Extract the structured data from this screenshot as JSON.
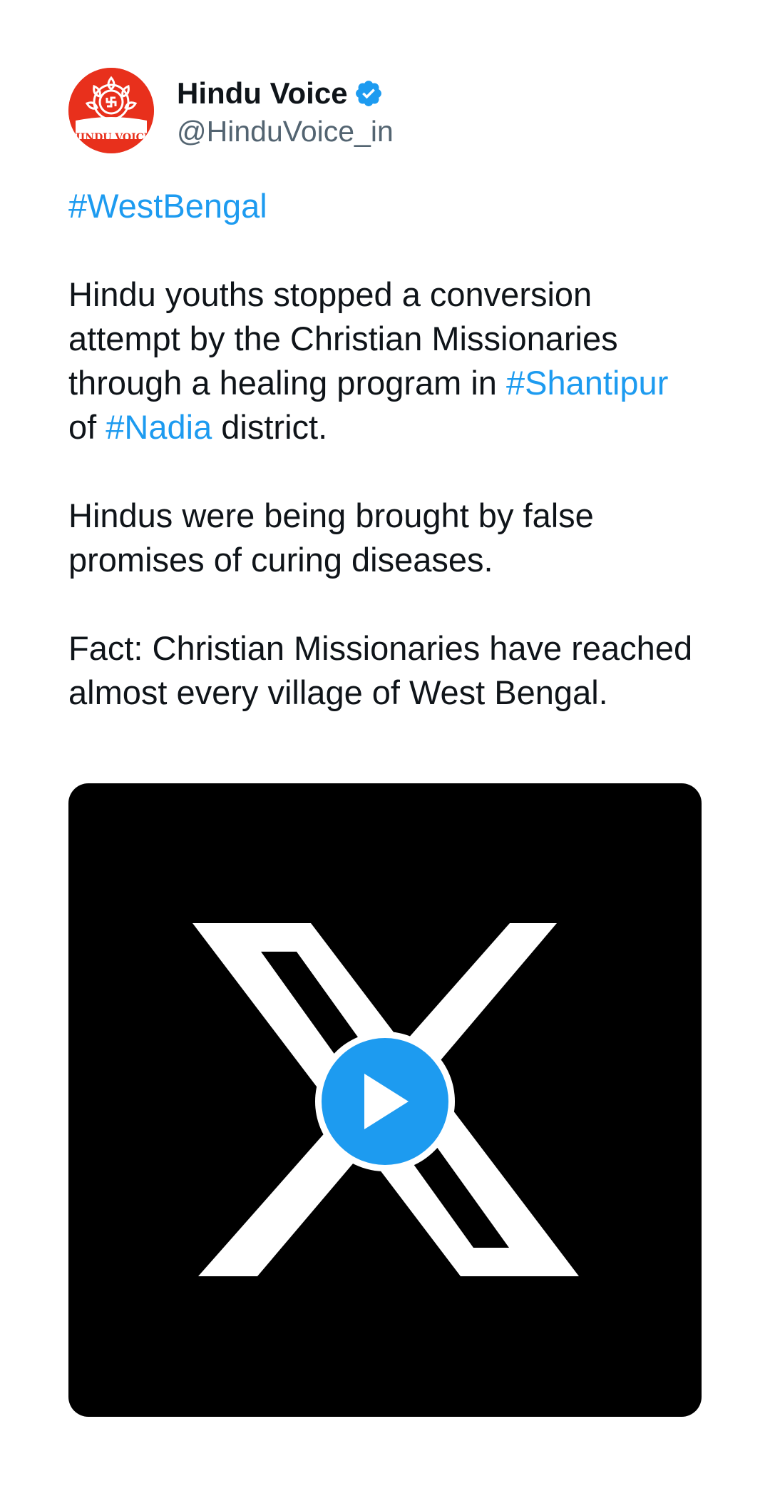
{
  "tweet": {
    "author": {
      "display_name": "Hindu Voice",
      "handle": "@HinduVoice_in",
      "verified": true,
      "avatar_text": "HINDU VOICE"
    },
    "body": {
      "p1_hashtag": "#WestBengal",
      "p2_text_a": "Hindu youths stopped a conversion attempt by the Christian Missionaries through a healing program in ",
      "p2_hashtag_1": "#Shantipur",
      "p2_text_b": " of ",
      "p2_hashtag_2": "#Nadia",
      "p2_text_c": " district.",
      "p3": "Hindus were being brought by false promises of curing diseases.",
      "p4": "Fact: Christian Missionaries have reached almost every village of West Bengal."
    },
    "media": {
      "type": "video",
      "thumbnail_icon": "x-logo-icon",
      "play_icon": "play-icon"
    }
  },
  "colors": {
    "link": "#1d9bf0",
    "text": "#0f1419",
    "secondary": "#536471",
    "avatar_bg": "#e8301c",
    "media_bg": "#000000"
  }
}
